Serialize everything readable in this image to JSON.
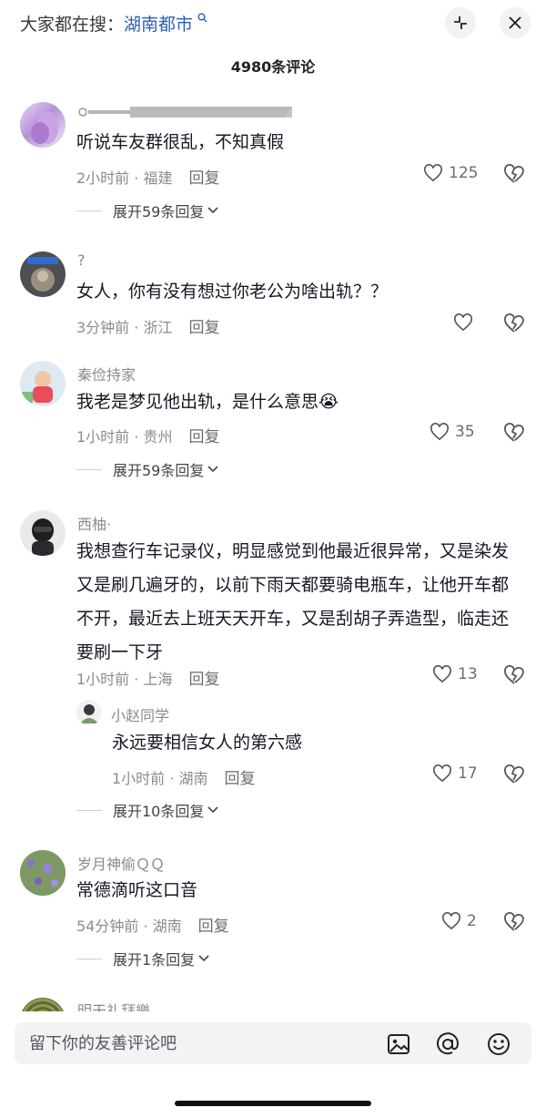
{
  "header": {
    "search_prefix": "大家都在搜：",
    "search_keyword": "湖南都市",
    "comment_count": "4980条评论"
  },
  "comments": [
    {
      "username": "",
      "text": "听说车友群很乱，不知真假",
      "meta": "2小时前 · 福建",
      "reply_label": "回复",
      "likes": "125",
      "expand": "展开59条回复"
    },
    {
      "username": "?",
      "text": "女人，你有没有想过你老公为啥出轨？？",
      "meta": "3分钟前 · 浙江",
      "reply_label": "回复",
      "likes": "",
      "expand": ""
    },
    {
      "username": "秦俭持家",
      "text": "我老是梦见他出轨，是什么意思😭",
      "meta": "1小时前 · 贵州",
      "reply_label": "回复",
      "likes": "35",
      "expand": "展开59条回复"
    },
    {
      "username": "西柚·",
      "text": "我想查行车记录仪，明显感觉到他最近很异常，又是染发又是刷几遍牙的，以前下雨天都要骑电瓶车，让他开车都不开，最近去上班天天开车，又是刮胡子弄造型，临走还要刷一下牙",
      "meta": "1小时前 · 上海",
      "reply_label": "回复",
      "likes": "13",
      "sub_reply": {
        "username": "小赵同学",
        "text": "永远要相信女人的第六感",
        "meta": "1小时前 · 湖南",
        "reply_label": "回复",
        "likes": "17"
      },
      "expand": "展开10条回复"
    },
    {
      "username": "岁月神偷ＱＱ",
      "text": "常德滴听这口音",
      "meta": "54分钟前 · 湖南",
      "reply_label": "回复",
      "likes": "2",
      "expand": "展开1条回复"
    }
  ],
  "partial_next": {
    "username": "明天礼拜樂"
  },
  "input": {
    "placeholder": "留下你的友善评论吧"
  },
  "icons": {
    "shrink": "collapse-icon",
    "close": "close-icon",
    "like": "heart-outline-icon",
    "dislike": "broken-heart-icon",
    "image": "image-icon",
    "mention": "at-icon",
    "emoji": "emoji-icon"
  },
  "colors": {
    "keyword": "#2b5fb8",
    "muted": "#8a8b91",
    "text": "#161823"
  }
}
